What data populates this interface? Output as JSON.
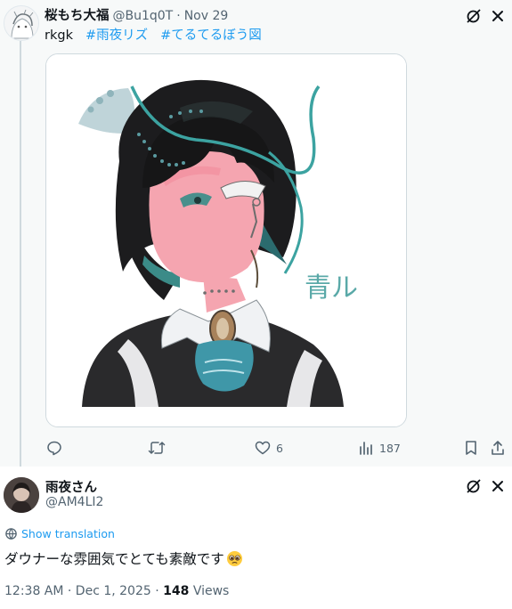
{
  "parent": {
    "author_name": "桜もち大福",
    "author_handle": "@Bu1q0T",
    "separator": "·",
    "date": "Nov 29",
    "text": "rkgk",
    "hashtags": [
      "#雨夜リズ",
      "#てるてるぼう図"
    ],
    "image_signature": "青ル",
    "actions": {
      "likes": "6",
      "views": "187"
    }
  },
  "reply": {
    "author_name": "雨夜さん",
    "author_handle": "@AM4LI2",
    "show_translation": "Show translation",
    "text": "ダウナーな雰囲気でとても素敵です",
    "time": "12:38 AM · Dec 1, 2025 · ",
    "views_count": "148",
    "views_label": " Views"
  },
  "colors": {
    "accent": "#1d9bf0",
    "secondary_text": "#536471",
    "parent_bg": "#f7f9f9",
    "border": "#cfd9de"
  },
  "icons": [
    "grok-icon",
    "close-icon",
    "reply-icon",
    "retweet-icon",
    "like-icon",
    "views-icon",
    "bookmark-icon",
    "share-icon",
    "globe-icon",
    "pleading-face-emoji"
  ]
}
